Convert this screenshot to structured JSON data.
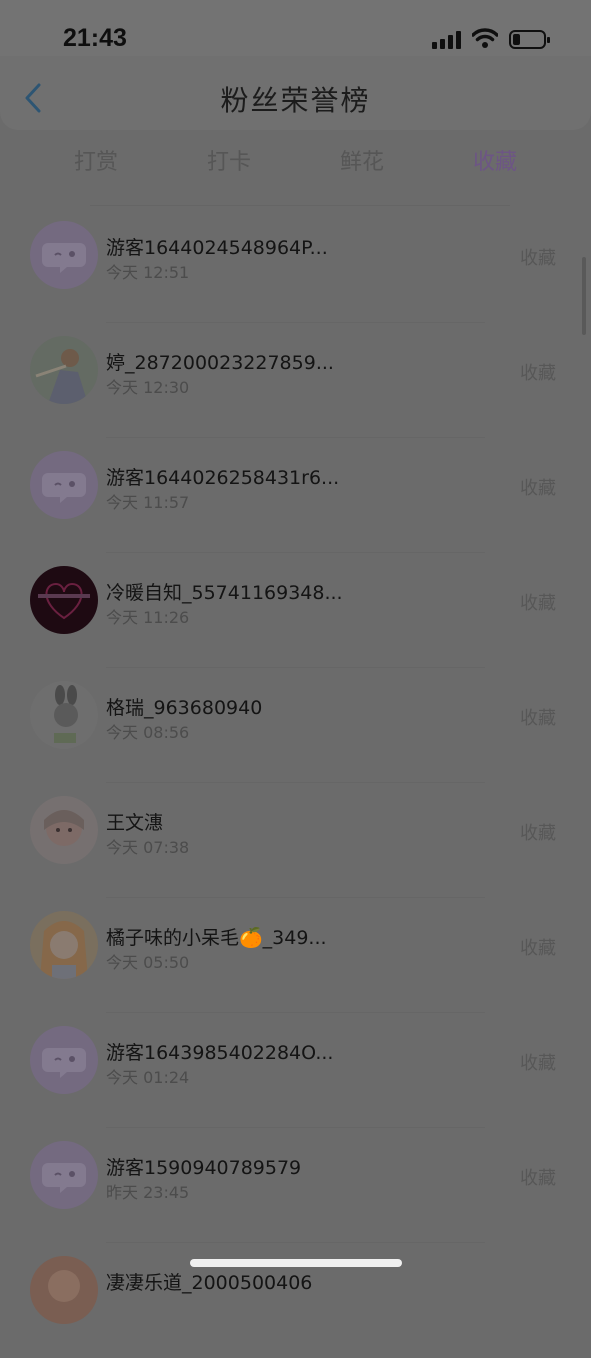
{
  "status": {
    "time": "21:43"
  },
  "header": {
    "title": "粉丝荣誉榜"
  },
  "tabs": [
    {
      "label": "打赏"
    },
    {
      "label": "打卡"
    },
    {
      "label": "鲜花"
    },
    {
      "label": "收藏"
    }
  ],
  "rows": [
    {
      "name": "游客1644024548964P...",
      "time": "今天 12:51",
      "action": "收藏",
      "avatar": "guest-avatar"
    },
    {
      "name": "婷_287200023227859...",
      "time": "今天 12:30",
      "action": "收藏",
      "avatar": "photo-avatar"
    },
    {
      "name": "游客1644026258431r6...",
      "time": "今天 11:57",
      "action": "收藏",
      "avatar": "guest-avatar"
    },
    {
      "name": "冷暖自知_55741169348...",
      "time": "今天 11:26",
      "action": "收藏",
      "avatar": "photo-avatar"
    },
    {
      "name": "格瑞_963680940",
      "time": "今天 08:56",
      "action": "收藏",
      "avatar": "photo-avatar"
    },
    {
      "name": "王文潓",
      "time": "今天 07:38",
      "action": "收藏",
      "avatar": "photo-avatar"
    },
    {
      "name": "橘子味的小呆毛🍊_349...",
      "time": "今天 05:50",
      "action": "收藏",
      "avatar": "photo-avatar"
    },
    {
      "name": "游客1643985402284O...",
      "time": "今天 01:24",
      "action": "收藏",
      "avatar": "guest-avatar"
    },
    {
      "name": "游客1590940789579",
      "time": "昨天 23:45",
      "action": "收藏",
      "avatar": "guest-avatar"
    },
    {
      "name": "凄凄乐道_2000500406",
      "time": "",
      "action": "",
      "avatar": "photo-avatar"
    }
  ],
  "colors": {
    "accent": "#6d5585",
    "overlay": "#6b6b6b"
  }
}
